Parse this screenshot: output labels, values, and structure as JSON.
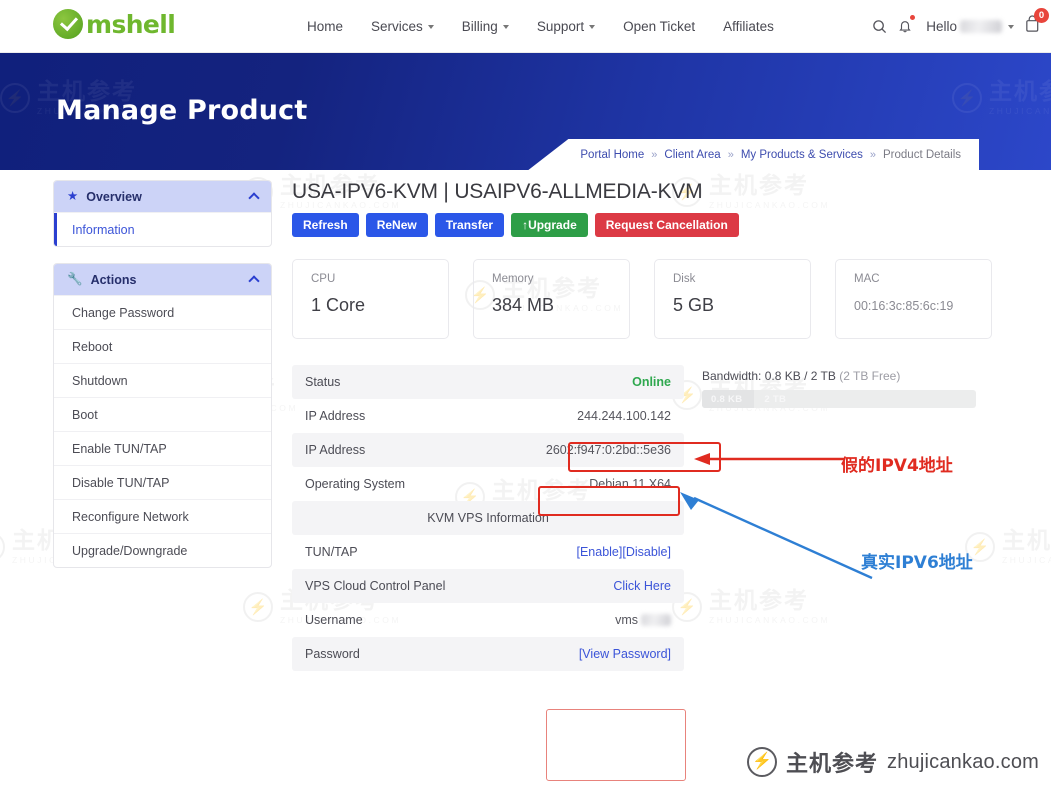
{
  "navbar": {
    "brand": "mshell",
    "links": [
      {
        "label": "Home",
        "has_caret": false
      },
      {
        "label": "Services",
        "has_caret": true
      },
      {
        "label": "Billing",
        "has_caret": true
      },
      {
        "label": "Support",
        "has_caret": true
      },
      {
        "label": "Open Ticket",
        "has_caret": false
      },
      {
        "label": "Affiliates",
        "has_caret": false
      }
    ],
    "search_icon": "search-icon",
    "bell_icon": "bell-icon",
    "greeting": "Hello",
    "cart_icon": "cart-icon",
    "cart_count": "0"
  },
  "hero": {
    "title": "Manage Product",
    "breadcrumb": [
      {
        "label": "Portal Home",
        "current": false
      },
      {
        "label": "Client Area",
        "current": false
      },
      {
        "label": "My Products & Services",
        "current": false
      },
      {
        "label": "Product Details",
        "current": true
      }
    ],
    "separator": "»"
  },
  "sidebar": {
    "groups": [
      {
        "title": "Overview",
        "icon": "star-icon",
        "items": [
          {
            "label": "Information",
            "active": true
          }
        ]
      },
      {
        "title": "Actions",
        "icon": "wrench-icon",
        "items": [
          {
            "label": "Change Password",
            "active": false
          },
          {
            "label": "Reboot",
            "active": false
          },
          {
            "label": "Shutdown",
            "active": false
          },
          {
            "label": "Boot",
            "active": false
          },
          {
            "label": "Enable TUN/TAP",
            "active": false
          },
          {
            "label": "Disable TUN/TAP",
            "active": false
          },
          {
            "label": "Reconfigure Network",
            "active": false
          },
          {
            "label": "Upgrade/Downgrade",
            "active": false
          }
        ]
      }
    ]
  },
  "main": {
    "product_title": "USA-IPV6-KVM | USAIPV6-ALLMEDIA-KVM",
    "buttons": [
      {
        "label": "Refresh",
        "style": "blue"
      },
      {
        "label": "ReNew",
        "style": "blue"
      },
      {
        "label": "Transfer",
        "style": "blue"
      },
      {
        "label": "↑Upgrade",
        "style": "green"
      },
      {
        "label": "Request Cancellation",
        "style": "red"
      }
    ],
    "stats": [
      {
        "label": "CPU",
        "value": "1 Core",
        "muted": false
      },
      {
        "label": "Memory",
        "value": "384 MB",
        "muted": false
      },
      {
        "label": "Disk",
        "value": "5 GB",
        "muted": false
      },
      {
        "label": "MAC",
        "value": "00:16:3c:85:6c:19",
        "muted": true
      }
    ],
    "rows": [
      {
        "label": "Status",
        "value": "Online",
        "kind": "online",
        "band": "alt"
      },
      {
        "label": "IP Address",
        "value": "244.244.100.142",
        "kind": "gray",
        "band": "plain"
      },
      {
        "label": "IP Address",
        "value": "2602:f947:0:2bd::5e36",
        "kind": "gray",
        "band": "alt"
      },
      {
        "label": "Operating System",
        "value": "Debian 11 X64",
        "kind": "gray",
        "band": "plain"
      },
      {
        "label": "KVM VPS Information",
        "value": "",
        "kind": "center",
        "band": "alt"
      },
      {
        "label": "TUN/TAP",
        "value": "[Enable][Disable]",
        "kind": "link",
        "band": "plain"
      },
      {
        "label": "VPS Cloud Control Panel",
        "value": "Click Here",
        "kind": "link",
        "band": "alt"
      },
      {
        "label": "Username",
        "value": "vms",
        "kind": "blurred",
        "band": "plain"
      },
      {
        "label": "Password",
        "value": "[View Password]",
        "kind": "link",
        "band": "alt"
      }
    ],
    "bandwidth": {
      "text": "Bandwidth: 0.8 KB / 2 TB",
      "free": "(2 TB Free)",
      "used_label": "0.8 KB",
      "total_label": "2 TB"
    }
  },
  "annotations": [
    {
      "text": "假的IPV4地址",
      "color": "red"
    },
    {
      "text": "真实IPV6地址",
      "color": "blue"
    }
  ],
  "watermark": {
    "cn": "主机参考",
    "en": "ZHUJICANKAO.COM",
    "footer_cn": "主机参考",
    "footer_en": "zhujicankao.com"
  }
}
